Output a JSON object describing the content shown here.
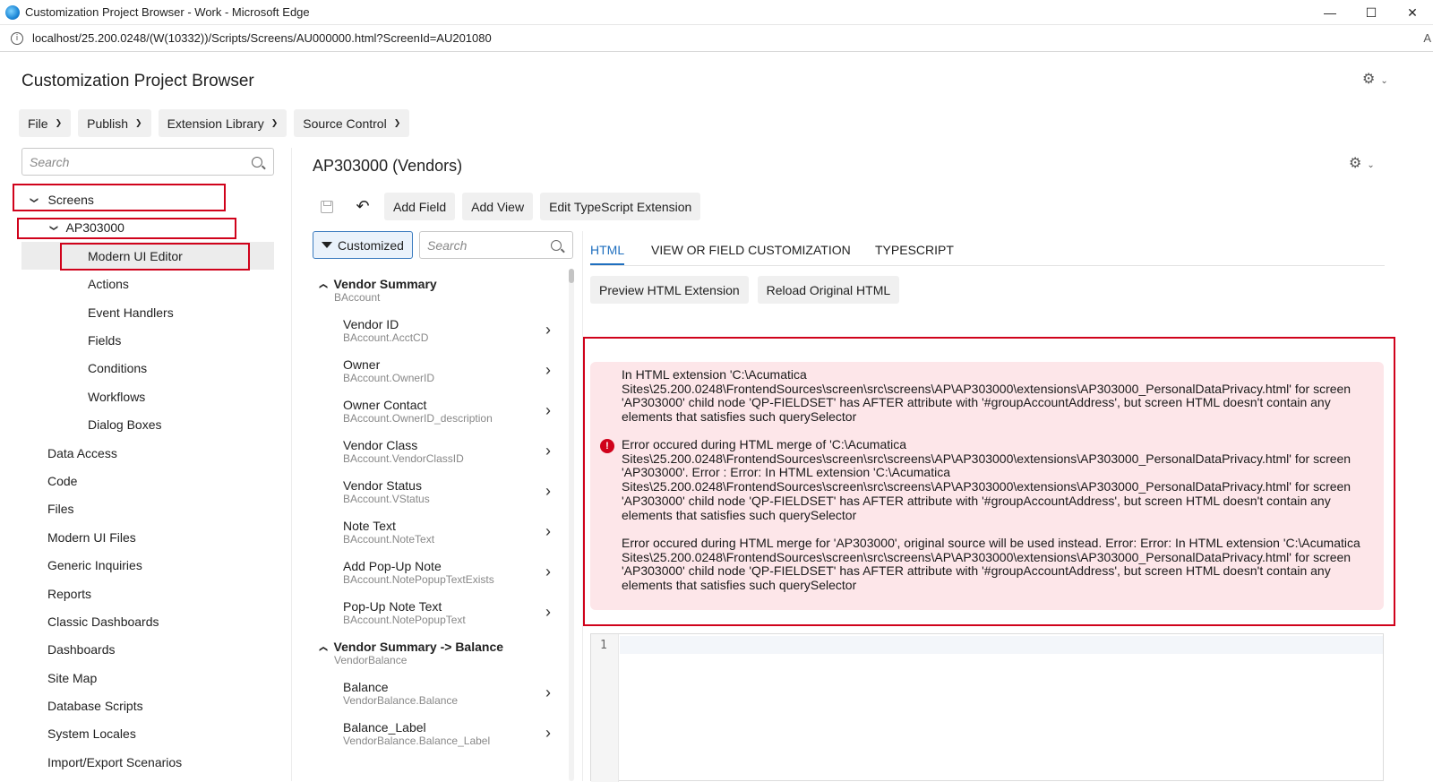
{
  "browser": {
    "window_title": "Customization Project Browser - Work - Microsoft Edge",
    "url": "localhost/25.200.0248/(W(10332))/Scripts/Screens/AU000000.html?ScreenId=AU201080",
    "reader_glyph": "A",
    "minimize": "—",
    "maximize": "☐",
    "close": "✕"
  },
  "app": {
    "title": "Customization Project Browser",
    "menu": [
      "File",
      "Publish",
      "Extension Library",
      "Source Control"
    ]
  },
  "left": {
    "search_placeholder": "Search",
    "tree": {
      "screens": "Screens",
      "screen_id": "AP303000",
      "children": [
        "Modern UI Editor",
        "Actions",
        "Event Handlers",
        "Fields",
        "Conditions",
        "Workflows",
        "Dialog Boxes"
      ],
      "top_level": [
        "Data Access",
        "Code",
        "Files",
        "Modern UI Files",
        "Generic Inquiries",
        "Reports",
        "Classic Dashboards",
        "Dashboards",
        "Site Map",
        "Database Scripts",
        "System Locales",
        "Import/Export Scenarios"
      ]
    }
  },
  "screen": {
    "title": "AP303000 (Vendors)",
    "toolbar": [
      "Add Field",
      "Add View",
      "Edit TypeScript Extension"
    ]
  },
  "fields": {
    "filter_label": "Customized",
    "search_placeholder": "Search",
    "groups": [
      {
        "name": "Vendor Summary",
        "sub": "BAccount",
        "items": [
          {
            "label": "Vendor ID",
            "sub": "BAccount.AcctCD"
          },
          {
            "label": "Owner",
            "sub": "BAccount.OwnerID"
          },
          {
            "label": "Owner Contact",
            "sub": "BAccount.OwnerID_description"
          },
          {
            "label": "Vendor Class",
            "sub": "BAccount.VendorClassID"
          },
          {
            "label": "Vendor Status",
            "sub": "BAccount.VStatus"
          },
          {
            "label": "Note Text",
            "sub": "BAccount.NoteText"
          },
          {
            "label": "Add Pop-Up Note",
            "sub": "BAccount.NotePopupTextExists"
          },
          {
            "label": "Pop-Up Note Text",
            "sub": "BAccount.NotePopupText"
          }
        ]
      },
      {
        "name": "Vendor Summary -> Balance",
        "sub": "VendorBalance",
        "items": [
          {
            "label": "Balance",
            "sub": "VendorBalance.Balance"
          },
          {
            "label": "Balance_Label",
            "sub": "VendorBalance.Balance_Label"
          }
        ]
      }
    ]
  },
  "right": {
    "tabs": [
      "HTML",
      "VIEW OR FIELD CUSTOMIZATION",
      "TYPESCRIPT"
    ],
    "buttons": [
      "Preview HTML Extension",
      "Reload Original HTML"
    ],
    "errors": [
      "In HTML extension 'C:\\Acumatica Sites\\25.200.0248\\FrontendSources\\screen\\src\\screens\\AP\\AP303000\\extensions\\AP303000_PersonalDataPrivacy.html' for screen 'AP303000' child node 'QP-FIELDSET' has AFTER attribute with '#groupAccountAddress', but screen HTML doesn't contain any elements that satisfies such querySelector",
      "Error occured during HTML merge of 'C:\\Acumatica Sites\\25.200.0248\\FrontendSources\\screen\\src\\screens\\AP\\AP303000\\extensions\\AP303000_PersonalDataPrivacy.html' for screen 'AP303000'. Error : Error: In HTML extension 'C:\\Acumatica Sites\\25.200.0248\\FrontendSources\\screen\\src\\screens\\AP\\AP303000\\extensions\\AP303000_PersonalDataPrivacy.html' for screen 'AP303000' child node 'QP-FIELDSET' has AFTER attribute with '#groupAccountAddress', but screen HTML doesn't contain any elements that satisfies such querySelector",
      "Error occured during HTML merge for 'AP303000', original source will be used instead. Error: Error: In HTML extension 'C:\\Acumatica Sites\\25.200.0248\\FrontendSources\\screen\\src\\screens\\AP\\AP303000\\extensions\\AP303000_PersonalDataPrivacy.html' for screen 'AP303000' child node 'QP-FIELDSET' has AFTER attribute with '#groupAccountAddress', but screen HTML doesn't contain any elements that satisfies such querySelector"
    ],
    "editor_line": "1"
  },
  "colors": {
    "highlight_box": "#d0021b",
    "error_background": "#fde6e9",
    "accent": "#1f6fbf"
  }
}
